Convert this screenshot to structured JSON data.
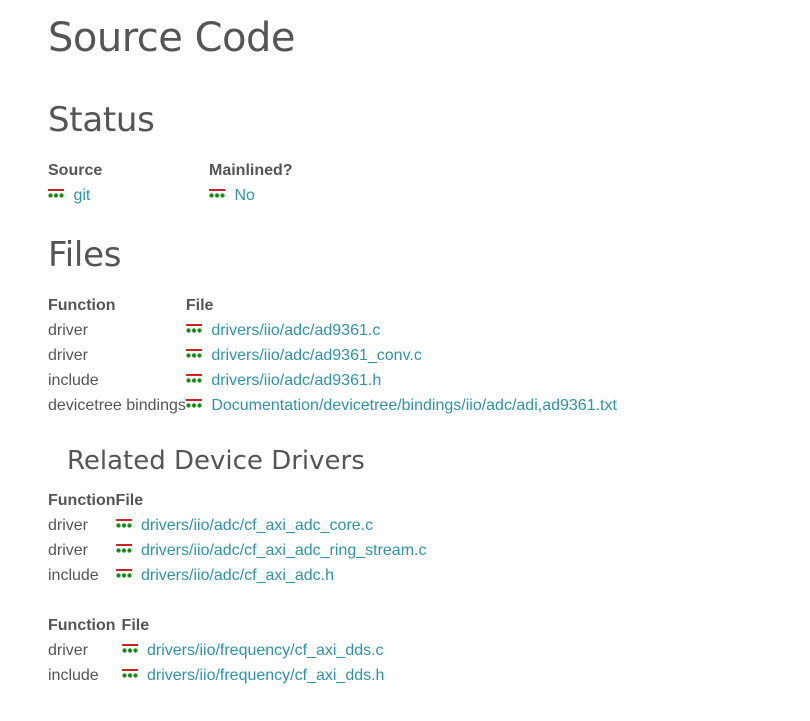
{
  "title": "Source Code",
  "status": {
    "heading": "Status",
    "headers": {
      "source": "Source",
      "mainlined": "Mainlined?"
    },
    "source_link": "git",
    "mainlined_link": "No"
  },
  "files": {
    "heading": "Files",
    "headers": {
      "function": "Function",
      "file": "File"
    },
    "rows": [
      {
        "function": "driver",
        "file": "drivers/iio/adc/ad9361.c"
      },
      {
        "function": "driver",
        "file": "drivers/iio/adc/ad9361_conv.c"
      },
      {
        "function": "include",
        "file": "drivers/iio/adc/ad9361.h"
      },
      {
        "function": "devicetree bindings",
        "file": "Documentation/devicetree/bindings/iio/adc/adi,ad9361.txt"
      }
    ]
  },
  "related": {
    "heading": "Related Device Drivers",
    "table1": {
      "headers": {
        "function": "Function",
        "file": "File"
      },
      "rows": [
        {
          "function": "driver",
          "file": "drivers/iio/adc/cf_axi_adc_core.c"
        },
        {
          "function": "driver",
          "file": "drivers/iio/adc/cf_axi_adc_ring_stream.c"
        },
        {
          "function": "include",
          "file": "drivers/iio/adc/cf_axi_adc.h"
        }
      ]
    },
    "table2": {
      "headers": {
        "function": "Function",
        "file": "File"
      },
      "rows": [
        {
          "function": "driver",
          "file": "drivers/iio/frequency/cf_axi_dds.c"
        },
        {
          "function": "include",
          "file": "drivers/iio/frequency/cf_axi_dds.h"
        }
      ]
    }
  },
  "colors": {
    "link": "#2e93a8",
    "text": "#555555",
    "icon_red": "#cc2222",
    "icon_green": "#229922"
  },
  "icons": {
    "repo": "git-repo-icon"
  }
}
